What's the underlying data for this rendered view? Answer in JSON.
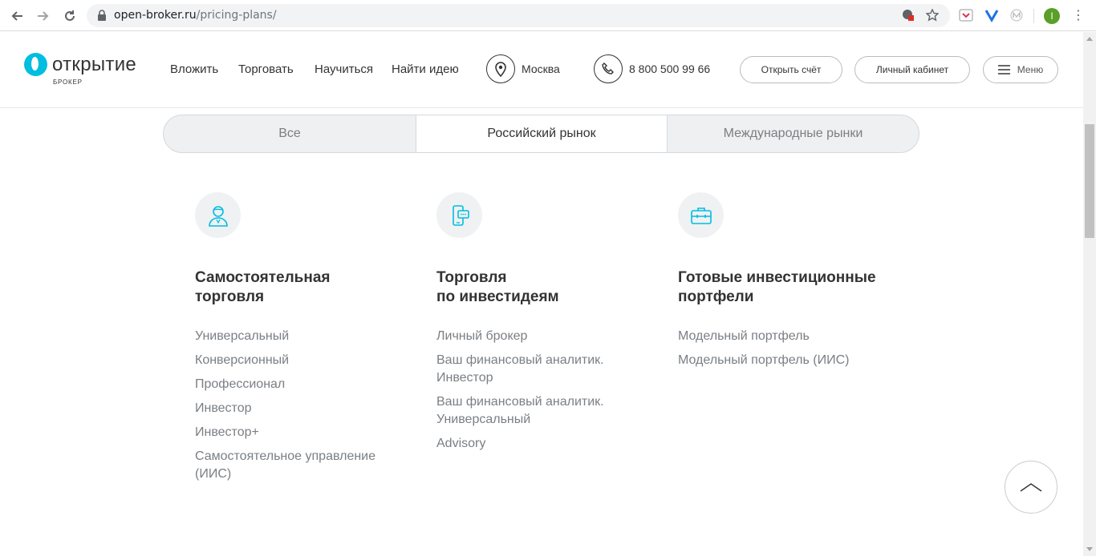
{
  "browser": {
    "url_host": "open-broker.ru",
    "url_path": "/pricing-plans/",
    "profile_initial": "I"
  },
  "header": {
    "logo_name": "ОТКРЫТИЕ",
    "logo_sub": "БРОКЕР",
    "nav": [
      "Вложить",
      "Торговать",
      "Научиться",
      "Найти идею"
    ],
    "city": "Москва",
    "phone": "8 800 500 99 66",
    "open_account": "Открыть счёт",
    "personal_cabinet": "Личный кабинет",
    "menu": "Меню"
  },
  "tabs": [
    {
      "label": "Все",
      "active": false
    },
    {
      "label": "Российский рынок",
      "active": true
    },
    {
      "label": "Международные рынки",
      "active": false
    }
  ],
  "columns": [
    {
      "icon": "user-icon",
      "title": [
        "Самостоятельная",
        "торговля"
      ],
      "items": [
        [
          "Универсальный"
        ],
        [
          "Конверсионный"
        ],
        [
          "Профессионал"
        ],
        [
          "Инвестор"
        ],
        [
          "Инвестор+"
        ],
        [
          "Самостоятельное управление",
          "(ИИС)"
        ]
      ]
    },
    {
      "icon": "phone-chat-icon",
      "title": [
        "Торговля",
        "по инвестидеям"
      ],
      "items": [
        [
          "Личный брокер"
        ],
        [
          "Ваш финансовый аналитик.",
          "Инвестор"
        ],
        [
          "Ваш финансовый аналитик.",
          "Универсальный"
        ],
        [
          "Advisory"
        ]
      ]
    },
    {
      "icon": "briefcase-icon",
      "title": [
        "Готовые инвестиционные",
        "портфели"
      ],
      "items": [
        [
          "Модельный портфель"
        ],
        [
          "Модельный портфель (ИИС)"
        ]
      ]
    }
  ],
  "colors": {
    "accent": "#00bee0",
    "text_dark": "#333333",
    "text_muted": "#7a7f84"
  }
}
